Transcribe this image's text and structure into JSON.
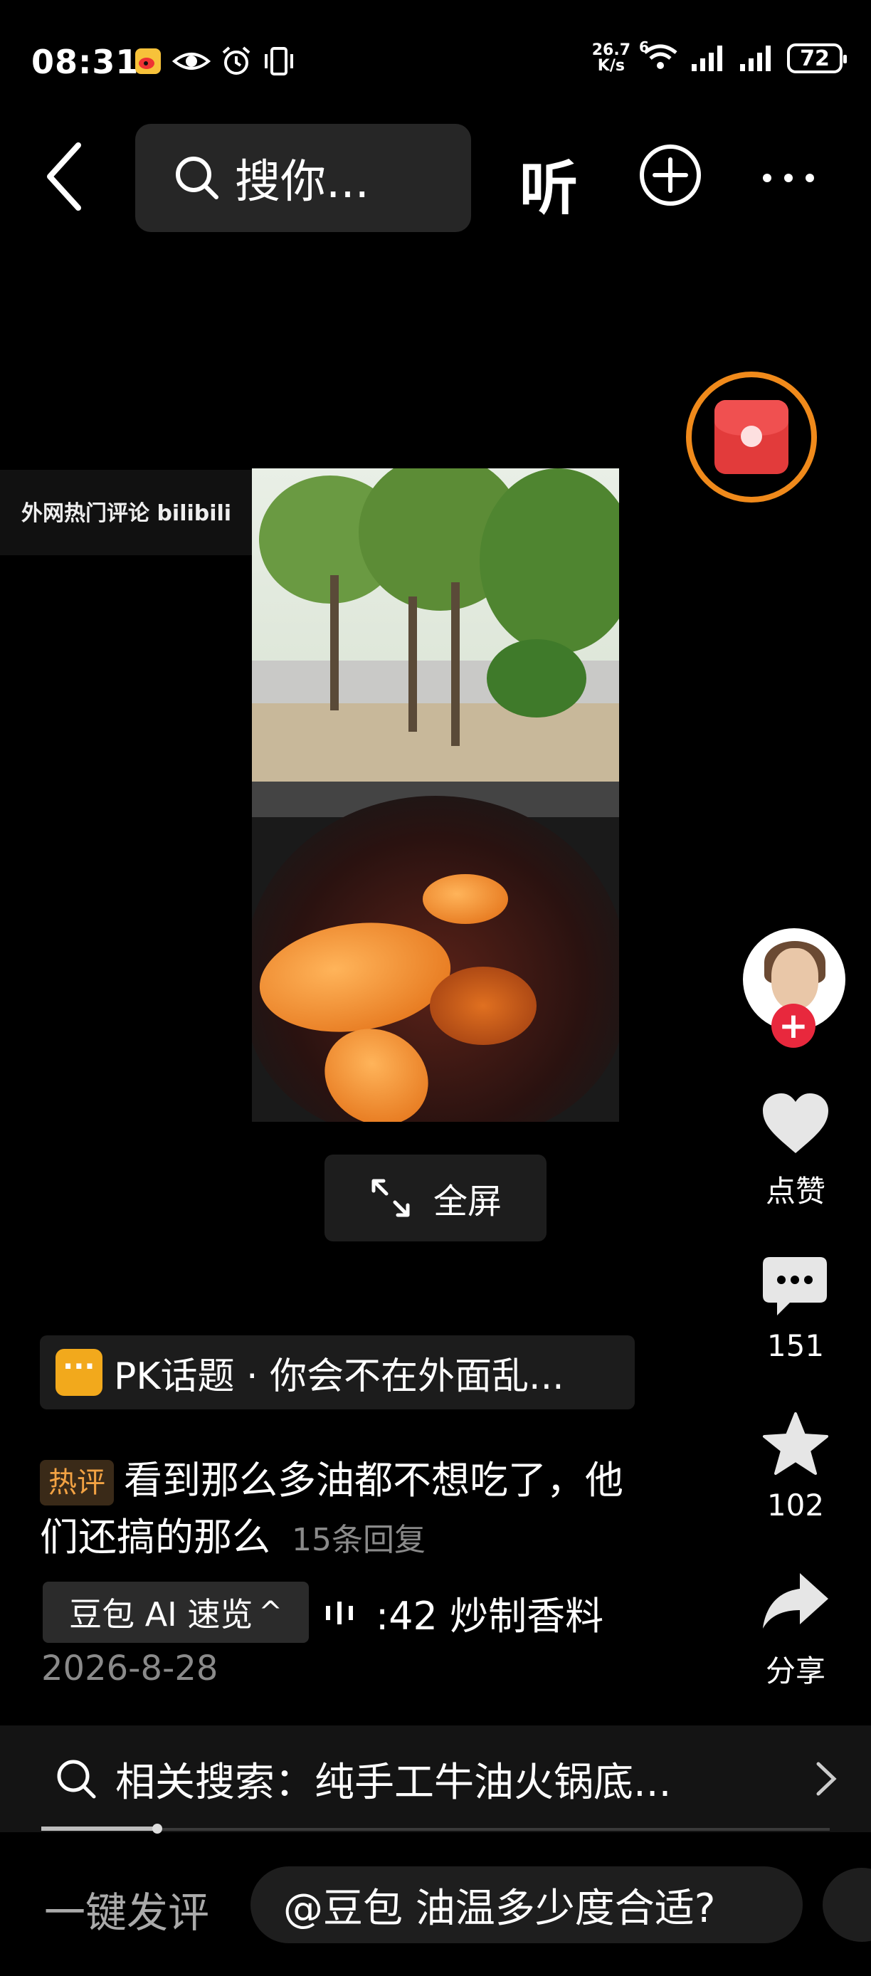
{
  "status_bar": {
    "time": "08:31",
    "net_speed_value": "26.7",
    "net_speed_unit": "K/s",
    "wifi_gen": "6",
    "battery": "72"
  },
  "top_bar": {
    "search_placeholder": "搜你...",
    "listen_label": "听"
  },
  "video": {
    "watermark": "外网热门评论 bilibili",
    "fullscreen_label": "全屏"
  },
  "right_rail": {
    "like_label": "点赞",
    "comment_count": "151",
    "favorite_count": "102",
    "share_label": "分享"
  },
  "topic": {
    "text": "PK话题 · 你会不在外面乱..."
  },
  "hot_comment": {
    "tag": "热评",
    "text": "看到那么多油都不想吃了，他们还搞的那么",
    "replies": "15条回复"
  },
  "ai_summary": {
    "chip_label": "豆包 AI 速览",
    "chip_caret": "^",
    "audio_text": ":42 炒制香料"
  },
  "post": {
    "date": "2026-8-28"
  },
  "related_search": {
    "text": "相关搜索：纯手工牛油火锅底..."
  },
  "bottom_bar": {
    "one_click_comment": "一键发评",
    "ai_prompt": "@豆包 油温多少度合适?"
  },
  "colors": {
    "accent_orange": "#f08a1b",
    "red_packet": "#e23b3b",
    "follow_red": "#e8283d",
    "hot_tag_text": "#f2a243",
    "pk_icon": "#f2a91c"
  }
}
